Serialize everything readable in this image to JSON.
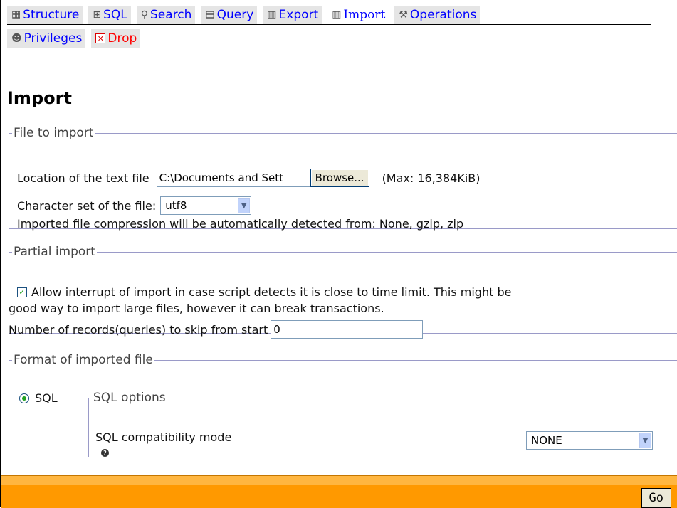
{
  "tabs": {
    "row1": [
      {
        "label": "Structure",
        "icon": "table-structure-icon",
        "glyph": "▦"
      },
      {
        "label": "SQL",
        "icon": "sql-icon",
        "glyph": "⊞"
      },
      {
        "label": "Search",
        "icon": "search-icon",
        "glyph": "⚲"
      },
      {
        "label": "Query",
        "icon": "query-icon",
        "glyph": "▤"
      },
      {
        "label": "Export",
        "icon": "export-icon",
        "glyph": "▥"
      },
      {
        "label": "Import",
        "icon": "import-icon",
        "glyph": "▥",
        "active": true
      },
      {
        "label": "Operations",
        "icon": "operations-icon",
        "glyph": "⚒"
      }
    ],
    "row2": [
      {
        "label": "Privileges",
        "icon": "privileges-icon",
        "glyph": "☻"
      },
      {
        "label": "Drop",
        "icon": "drop-icon",
        "glyph": "✕"
      }
    ]
  },
  "page_title": "Import",
  "file_section": {
    "legend": "File to import",
    "location_label": "Location of the text file",
    "file_value": "C:\\Documents and Sett",
    "browse_label": "Browse...",
    "max_label": "(Max: 16,384KiB)",
    "charset_label": "Character set of the file:",
    "charset_value": "utf8",
    "compression_text": "Imported file compression will be automatically detected from: None, gzip, zip"
  },
  "partial_section": {
    "legend": "Partial import",
    "allow_interrupt_line1": "Allow interrupt of import in case script detects it is close to time limit. This might be",
    "allow_interrupt_line2": "good way to import large files, however it can break transactions.",
    "allow_interrupt_checked": true,
    "skip_label": "Number of records(queries) to skip from start",
    "skip_value": "0"
  },
  "format_section": {
    "legend": "Format of imported file",
    "sql_radio_label": "SQL",
    "sql_options_legend": "SQL options",
    "compat_label": "SQL compatibility mode",
    "compat_value": "NONE",
    "help_glyph": "?"
  },
  "footer": {
    "go_label": "Go"
  }
}
